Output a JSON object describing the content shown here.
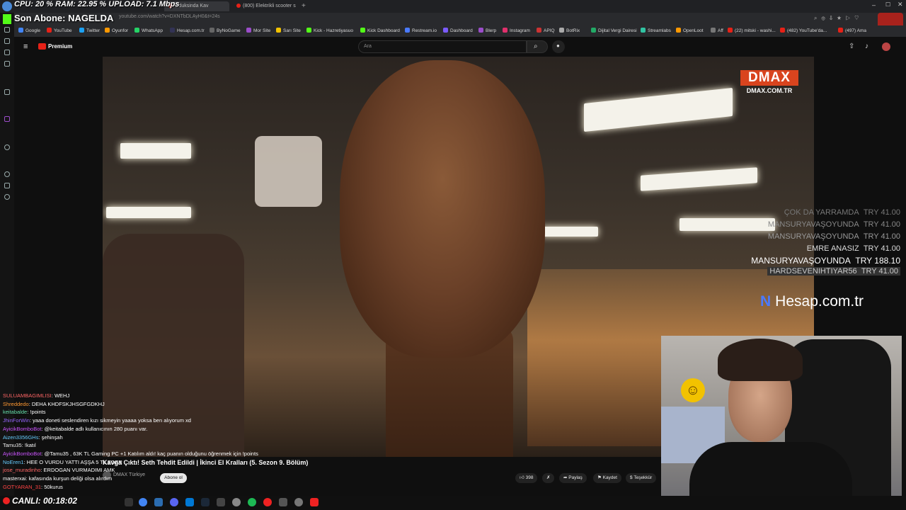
{
  "overlay": {
    "stats": "CPU: 20 % RAM:  22.95 % UPLOAD: 7.1 Mbps",
    "last_sub": "Son Abone: NAGELDA",
    "live_label": "CANLI: 00:18:02"
  },
  "browser": {
    "tabs": [
      {
        "label": "Oduksinda Kav"
      },
      {
        "label": "(800) Elektrikli scooter s"
      }
    ],
    "url": "youtube.com/watch?v=DXNTbDLAyH0&t=24s",
    "bookmarks": [
      "Google",
      "YouTube",
      "Twitter",
      "Oyunfor",
      "WhatsApp",
      "Hesap.com.tr",
      "ByNoGame",
      "Mor Site",
      "Sarı Site",
      "Kick - Hazretiyasuo",
      "Kick Dashboard",
      "Restream.io",
      "Dashboard",
      "Blerp",
      "Instagram",
      "APIQ",
      "BotRix",
      "Dijital Vergi Dairesi",
      "Streamlabs",
      "OpenLoot",
      "Aff",
      "(22) mitski - washi...",
      "(482) YouTube'da...",
      "(497) Ama"
    ]
  },
  "youtube": {
    "logo": "Premium",
    "search_placeholder": "Ara",
    "video_title": "Kavga Çıktı! Seth Tehdit Edildi | İkinci El Kralları (5. Sezon 9. Bölüm)",
    "channel": "DMAX Türkiye",
    "subscribe_label": "Abone ol",
    "likes": "398",
    "share_label": "Paylaş",
    "save_label": "Kaydet",
    "thanks_label": "Teşekkür"
  },
  "watermark": {
    "logo": "DMAX",
    "url": "DMAX.COM.TR"
  },
  "donations": [
    {
      "name": "ÇOK DA YARRAMDA",
      "amount": "TRY 41.00",
      "color": "#777777"
    },
    {
      "name": "MANSURYAVAŞOYUNDA",
      "amount": "TRY 41.00",
      "color": "#888888"
    },
    {
      "name": "MANSURYAVAŞOYUNDA",
      "amount": "TRY 41.00",
      "color": "#999999"
    },
    {
      "name": "EMRE ANASIZ",
      "amount": "TRY 41.00",
      "color": "#dddddd"
    },
    {
      "name": "MANSURYAVAŞOYUNDA",
      "amount": "TRY 188.10",
      "color": "#ffffff"
    },
    {
      "name": "HARDSEVENIHTIYAR56",
      "amount": "TRY 41.00",
      "color": "#cccccc"
    }
  ],
  "sponsor": "Hesap.com.tr",
  "chat": [
    {
      "user": "SULUAMBAGIMLISI",
      "msg": "WEHJ",
      "color": "#ff6666"
    },
    {
      "user": "Shreddedo",
      "msg": "DEHA KHDFSKJHSGFGDKHJ",
      "color": "#ff9933"
    },
    {
      "user": "keitabalde",
      "msg": "!points",
      "color": "#66ddaa"
    },
    {
      "user": "JhinForWin",
      "msg": "yaaa doneti seslendiren kızı sikmeyin yaaaa yoksa ben alıyorum xd",
      "color": "#9966ff"
    },
    {
      "user": "AyicikBomboBot",
      "msg": "@keitabalde adlı kullanıcının 280 puanı var.",
      "color": "#cc55ff"
    },
    {
      "user": "Aizen3356GHs",
      "msg": "şehinşah",
      "color": "#66ccff"
    },
    {
      "user": "Tamu35",
      "msg": "!katıl",
      "color": "#eeeeee"
    },
    {
      "user": "AyicikBomboBot",
      "msg": "@Tamu35 , 63K TL Gaming PC +1 Katılım aldı! kaç puanın olduğunu öğrenmek için !points",
      "color": "#cc55ff"
    },
    {
      "user": "NoEren1",
      "msg": "HEE O VURDU YATTI AŞŞA 5 TL EDER",
      "color": "#66ccff"
    },
    {
      "user": "jose_muradinho",
      "msg": "ERDOGAN VURMADIMI AMK",
      "color": "#ff6666"
    },
    {
      "user": "masterxai",
      "msg": "kafasında kurşun deliği olsa alırdım",
      "color": "#ffffff"
    },
    {
      "user": "GOTYARAN_31",
      "msg": "50kurus",
      "color": "#ff4444"
    }
  ]
}
